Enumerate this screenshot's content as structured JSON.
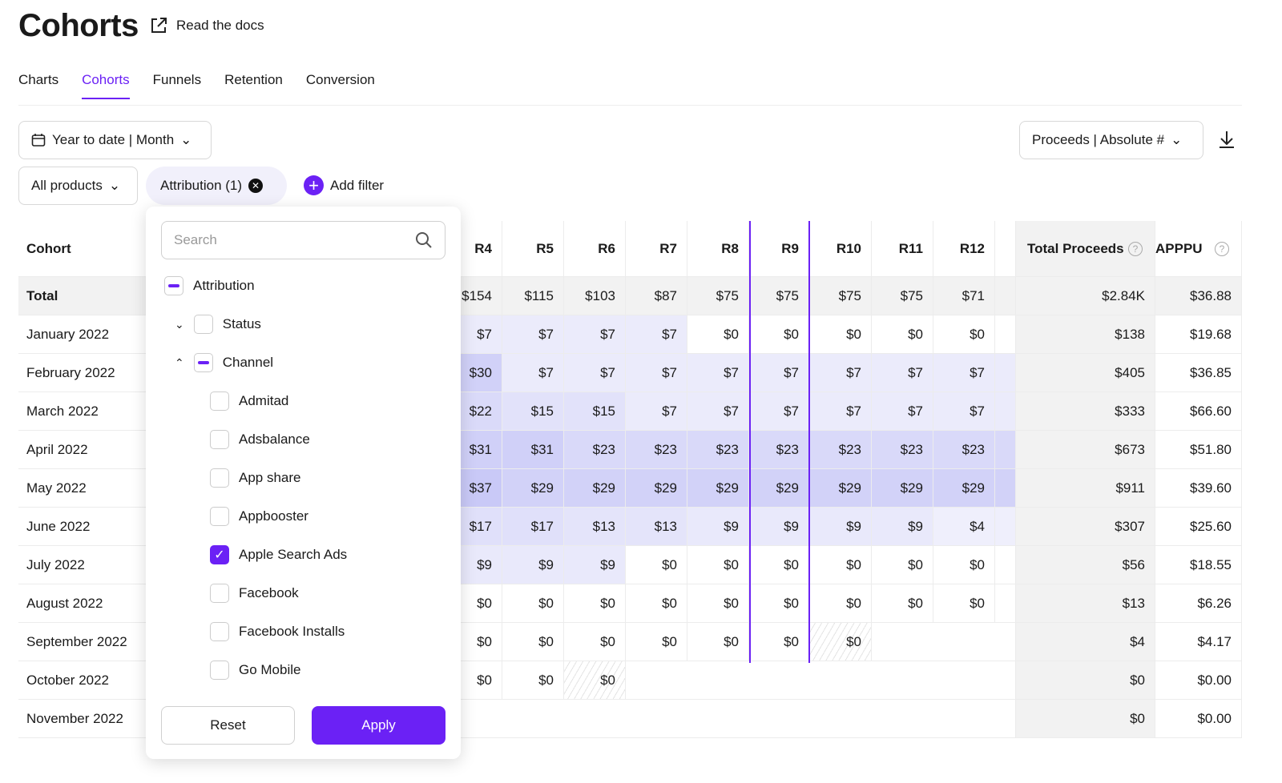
{
  "header": {
    "title": "Cohorts",
    "docs_label": "Read the docs"
  },
  "tabs": [
    "Charts",
    "Cohorts",
    "Funnels",
    "Retention",
    "Conversion"
  ],
  "active_tab": "Cohorts",
  "toolbar": {
    "date_range": "Year to date | Month",
    "metric": "Proceeds | Absolute #",
    "products": "All products",
    "attribution_filter": "Attribution (1)",
    "add_filter": "Add filter"
  },
  "accent": "#6b21f5",
  "table": {
    "cohort_header": "Cohort",
    "columns": [
      "R4",
      "R5",
      "R6",
      "R7",
      "R8",
      "R9",
      "R10",
      "R11",
      "R12"
    ],
    "total_proceeds_header": "Total Proceeds",
    "apppu_header": "APPPU",
    "total": {
      "label": "Total",
      "values": [
        "$154",
        "$115",
        "$103",
        "$87",
        "$75",
        "$75",
        "$75",
        "$75",
        "$71"
      ],
      "proceeds": "$2.84K",
      "apppu": "$36.88"
    },
    "rows": [
      {
        "label": "January 2022",
        "values": [
          "$7",
          "$7",
          "$7",
          "$7",
          "$0",
          "$0",
          "$0",
          "$0",
          "$0"
        ],
        "proceeds": "$138",
        "apppu": "$19.68"
      },
      {
        "label": "February 2022",
        "values": [
          "$30",
          "$7",
          "$7",
          "$7",
          "$7",
          "$7",
          "$7",
          "$7",
          "$7"
        ],
        "proceeds": "$405",
        "apppu": "$36.85"
      },
      {
        "label": "March 2022",
        "values": [
          "$22",
          "$15",
          "$15",
          "$7",
          "$7",
          "$7",
          "$7",
          "$7",
          "$7"
        ],
        "proceeds": "$333",
        "apppu": "$66.60"
      },
      {
        "label": "April 2022",
        "values": [
          "$31",
          "$31",
          "$23",
          "$23",
          "$23",
          "$23",
          "$23",
          "$23",
          "$23"
        ],
        "proceeds": "$673",
        "apppu": "$51.80"
      },
      {
        "label": "May 2022",
        "values": [
          "$37",
          "$29",
          "$29",
          "$29",
          "$29",
          "$29",
          "$29",
          "$29",
          "$29"
        ],
        "proceeds": "$911",
        "apppu": "$39.60"
      },
      {
        "label": "June 2022",
        "values": [
          "$17",
          "$17",
          "$13",
          "$13",
          "$9",
          "$9",
          "$9",
          "$9",
          "$4"
        ],
        "proceeds": "$307",
        "apppu": "$25.60"
      },
      {
        "label": "July 2022",
        "values": [
          "$9",
          "$9",
          "$9",
          "$0",
          "$0",
          "$0",
          "$0",
          "$0",
          "$0"
        ],
        "proceeds": "$56",
        "apppu": "$18.55"
      },
      {
        "label": "August 2022",
        "values": [
          "$0",
          "$0",
          "$0",
          "$0",
          "$0",
          "$0",
          "$0",
          "$0",
          "$0"
        ],
        "proceeds": "$13",
        "apppu": "$6.26"
      },
      {
        "label": "September 2022",
        "values": [
          "$0",
          "$0",
          "$0",
          "$0",
          "$0",
          "$0",
          "$0"
        ],
        "incomplete_column": "R10",
        "proceeds": "$4",
        "apppu": "$4.17"
      },
      {
        "label": "October 2022",
        "values": [
          "$0",
          "$0",
          "$0"
        ],
        "incomplete_column": "R6",
        "proceeds": "$0",
        "apppu": "$0.00"
      },
      {
        "label": "November 2022",
        "values": [],
        "proceeds": "$0",
        "apppu": "$0.00"
      }
    ]
  },
  "popup": {
    "search_placeholder": "Search",
    "root": "Attribution",
    "status": "Status",
    "channel": "Channel",
    "channels": [
      {
        "label": "Admitad",
        "checked": false
      },
      {
        "label": "Adsbalance",
        "checked": false
      },
      {
        "label": "App share",
        "checked": false
      },
      {
        "label": "Appbooster",
        "checked": false
      },
      {
        "label": "Apple Search Ads",
        "checked": true
      },
      {
        "label": "Facebook",
        "checked": false
      },
      {
        "label": "Facebook Installs",
        "checked": false
      },
      {
        "label": "Go Mobile",
        "checked": false
      }
    ],
    "reset": "Reset",
    "apply": "Apply"
  }
}
